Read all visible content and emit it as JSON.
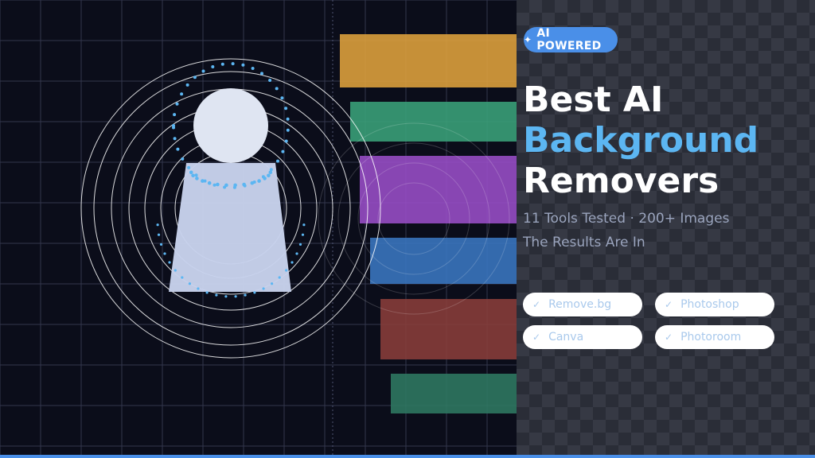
{
  "badge": {
    "label": "AI POWERED",
    "icon": "sparkle-icon"
  },
  "headline": {
    "line1": "Best AI",
    "line2": "Background",
    "line3": "Removers"
  },
  "subtitle": {
    "line1": "11 Tools Tested · 200+ Images",
    "line2": "The Results Are In"
  },
  "tools": [
    {
      "label": "Remove.bg"
    },
    {
      "label": "Photoshop"
    },
    {
      "label": "Canva"
    },
    {
      "label": "Photoroom"
    }
  ],
  "colors": {
    "background": "#0b0d1a",
    "accent": "#4a8fe8",
    "headline_accent": "#5cb6f2",
    "bars": [
      "#e0a33c",
      "#3aa37a",
      "#9a4fc8",
      "#3a78c2",
      "#8a3d3a",
      "#2f7a62"
    ]
  }
}
